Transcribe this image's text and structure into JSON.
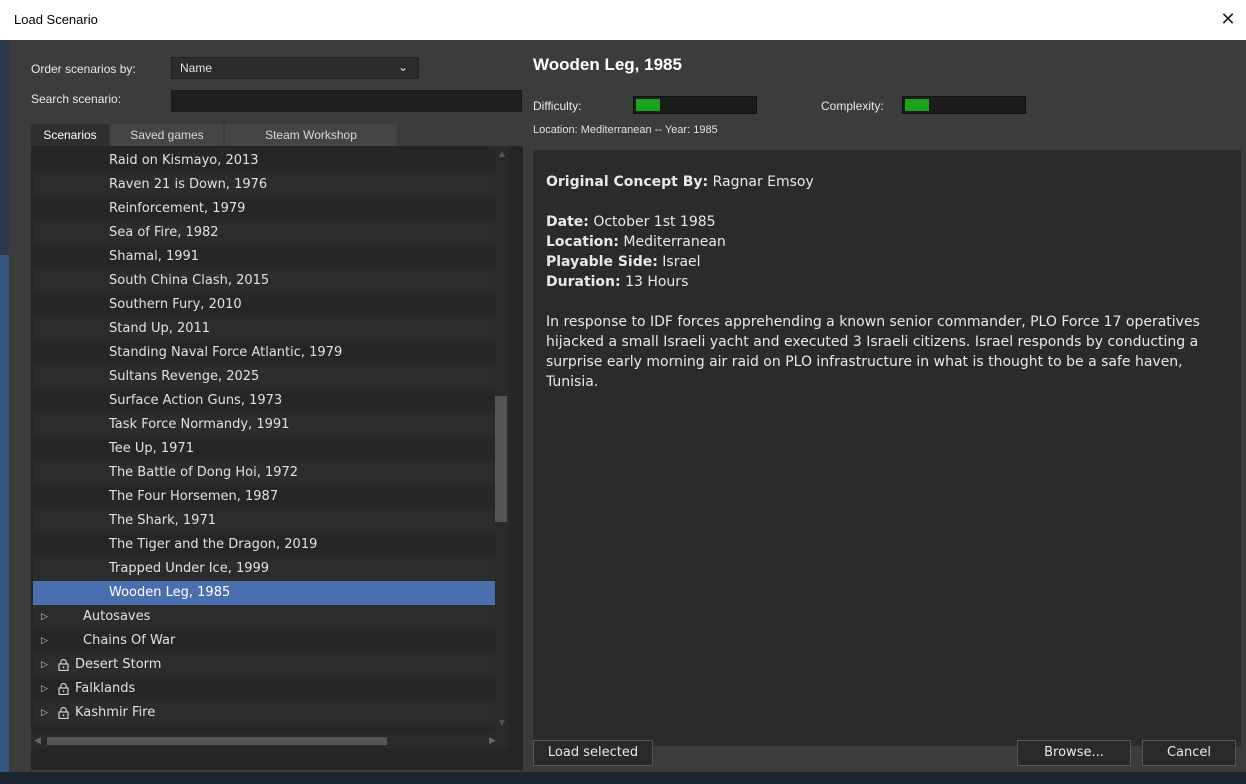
{
  "window": {
    "title": "Load Scenario",
    "close_glyph": "✕"
  },
  "left": {
    "order_label": "Order scenarios by:",
    "order_value": "Name",
    "search_label": "Search scenario:",
    "search_value": "",
    "tabs": [
      "Scenarios",
      "Saved games",
      "Steam Workshop"
    ],
    "scenarios": [
      "Raid on Kismayo, 2013",
      "Raven 21 is Down, 1976",
      "Reinforcement, 1979",
      "Sea of Fire, 1982",
      "Shamal, 1991",
      "South China Clash, 2015",
      "Southern Fury, 2010",
      "Stand Up, 2011",
      "Standing Naval Force Atlantic, 1979",
      "Sultans Revenge, 2025",
      "Surface Action Guns, 1973",
      "Task Force Normandy, 1991",
      "Tee Up, 1971",
      "The Battle of Dong Hoi, 1972",
      "The Four Horsemen, 1987",
      "The Shark, 1971",
      "The Tiger and the Dragon, 2019",
      "Trapped Under Ice, 1999",
      "Wooden Leg, 1985"
    ],
    "selected_index": 18,
    "folders": [
      {
        "label": "Autosaves",
        "locked": false
      },
      {
        "label": "Chains Of War",
        "locked": false
      },
      {
        "label": "Desert Storm",
        "locked": true
      },
      {
        "label": "Falklands",
        "locked": true
      },
      {
        "label": "Kashmir Fire",
        "locked": true
      }
    ]
  },
  "detail": {
    "title": "Wooden Leg, 1985",
    "difficulty_label": "Difficulty:",
    "difficulty_level": 0.2,
    "complexity_label": "Complexity:",
    "complexity_level": 0.2,
    "location_line": "Location: Mediterranean  --  Year: 1985",
    "concept_label": "Original Concept By:",
    "concept_value": "Ragnar Emsoy",
    "date_label": "Date:",
    "date_value": "October 1st 1985",
    "location_label": "Location:",
    "location_value": "Mediterranean",
    "side_label": "Playable Side:",
    "side_value": "Israel",
    "duration_label": "Duration:",
    "duration_value": "13 Hours",
    "description": "In response to IDF forces apprehending a known senior commander, PLO Force 17 operatives hijacked a small Israeli yacht and executed 3 Israeli citizens. Israel responds by conducting a surprise early morning air raid on PLO infrastructure in what is thought to be a safe haven, Tunisia."
  },
  "buttons": {
    "load": "Load selected",
    "browse": "Browse...",
    "cancel": "Cancel"
  },
  "colors": {
    "selection": "#4a6faf",
    "meter_fill": "#1aa31a",
    "panel_bg": "#3c3c3c"
  },
  "icons": {
    "close": "close-icon",
    "dropdown": "chevron-down-icon",
    "expand": "triangle-right-icon",
    "lock": "lock-icon"
  }
}
